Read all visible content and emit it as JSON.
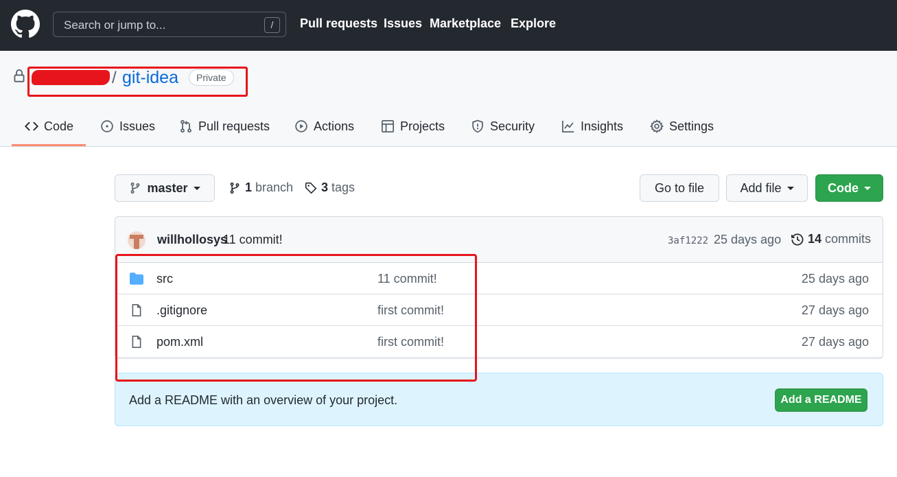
{
  "header": {
    "search_placeholder": "Search or jump to...",
    "search_shortcut": "/",
    "nav": [
      "Pull requests",
      "Issues",
      "Marketplace",
      "Explore"
    ]
  },
  "repo": {
    "separator": "/",
    "name": "git-idea",
    "visibility": "Private"
  },
  "tabs": [
    {
      "label": "Code",
      "icon": "code-icon",
      "active": true
    },
    {
      "label": "Issues",
      "icon": "issue-icon"
    },
    {
      "label": "Pull requests",
      "icon": "pull-request-icon"
    },
    {
      "label": "Actions",
      "icon": "play-icon"
    },
    {
      "label": "Projects",
      "icon": "table-icon"
    },
    {
      "label": "Security",
      "icon": "shield-icon"
    },
    {
      "label": "Insights",
      "icon": "graph-icon"
    },
    {
      "label": "Settings",
      "icon": "gear-icon"
    }
  ],
  "branch_bar": {
    "branch": "master",
    "branch_count": "1",
    "branch_word": "branch",
    "tag_count": "3",
    "tag_word": "tags",
    "goto_file": "Go to file",
    "add_file": "Add file",
    "code": "Code"
  },
  "latest_commit": {
    "author": "willhollosys",
    "message": "11 commit!",
    "sha": "3af1222",
    "time": "25 days ago",
    "count": "14",
    "count_word": "commits"
  },
  "files": [
    {
      "type": "folder",
      "name": "src",
      "message": "11 commit!",
      "age": "25 days ago"
    },
    {
      "type": "file",
      "name": ".gitignore",
      "message": "first commit!",
      "age": "27 days ago"
    },
    {
      "type": "file",
      "name": "pom.xml",
      "message": "first commit!",
      "age": "27 days ago"
    }
  ],
  "readme_banner": {
    "text": "Add a README with an overview of your project.",
    "button": "Add a README"
  },
  "colors": {
    "header_bg": "#24292f",
    "accent_green": "#2da44e",
    "link_blue": "#0969da",
    "annotation_red": "#e8141b",
    "tab_underline": "#fd8c73"
  }
}
